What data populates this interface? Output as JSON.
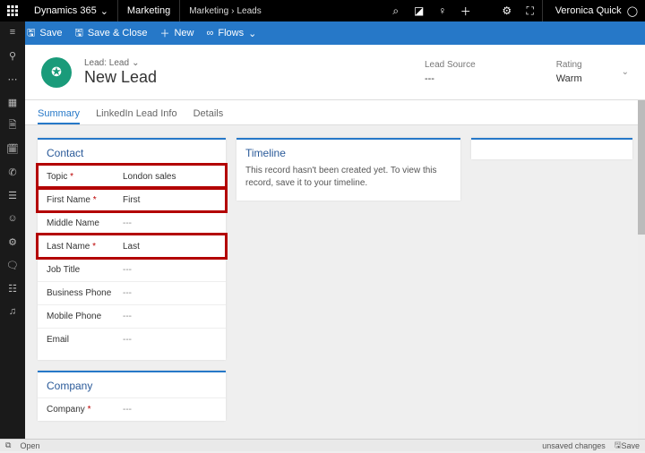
{
  "header": {
    "brand": "Dynamics 365",
    "app": "Marketing",
    "breadcrumb": [
      "Marketing",
      "Leads"
    ],
    "user": "Veronica Quick"
  },
  "commands": {
    "save": "Save",
    "saveclose": "Save & Close",
    "new": "New",
    "flows": "Flows"
  },
  "record": {
    "typelabel": "Lead: Lead",
    "title": "New Lead",
    "leadSourceLabel": "Lead Source",
    "leadSourceValue": "---",
    "ratingLabel": "Rating",
    "ratingValue": "Warm"
  },
  "tabs": {
    "summary": "Summary",
    "linkedin": "LinkedIn Lead Info",
    "details": "Details"
  },
  "contact": {
    "title": "Contact",
    "fields": {
      "topic": {
        "label": "Topic",
        "req": "*",
        "value": "London sales"
      },
      "firstName": {
        "label": "First Name",
        "req": "*",
        "value": "First"
      },
      "middleName": {
        "label": "Middle Name",
        "req": "",
        "value": "---"
      },
      "lastName": {
        "label": "Last Name",
        "req": "*",
        "value": "Last"
      },
      "jobTitle": {
        "label": "Job Title",
        "req": "",
        "value": "---"
      },
      "businessPhone": {
        "label": "Business Phone",
        "req": "",
        "value": "---"
      },
      "mobilePhone": {
        "label": "Mobile Phone",
        "req": "",
        "value": "---"
      },
      "email": {
        "label": "Email",
        "req": "",
        "value": "---"
      }
    }
  },
  "company": {
    "title": "Company",
    "fields": {
      "company": {
        "label": "Company",
        "req": "*",
        "value": "---"
      }
    }
  },
  "timeline": {
    "title": "Timeline",
    "message": "This record hasn't been created yet.  To view this record, save it to your timeline."
  },
  "footer": {
    "status": "Open",
    "unsaved": "unsaved changes",
    "save": "Save"
  }
}
